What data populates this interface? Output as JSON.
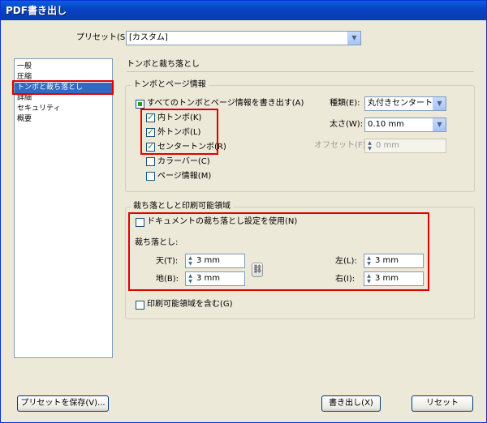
{
  "window": {
    "title": "PDF書き出し"
  },
  "preset": {
    "label": "プリセット(S):",
    "value": "[カスタム]"
  },
  "sidebar": {
    "items": [
      {
        "label": "一般"
      },
      {
        "label": "圧縮"
      },
      {
        "label": "トンボと裁ち落とし"
      },
      {
        "label": "詳細"
      },
      {
        "label": "セキュリティ"
      },
      {
        "label": "概要"
      }
    ]
  },
  "main": {
    "section_title": "トンボと裁ち落とし",
    "marks_group": {
      "title": "トンボとページ情報",
      "all_marks_label": "すべてのトンボとページ情報を書き出す(A)",
      "inner_trim_label": "内トンボ(K)",
      "outer_trim_label": "外トンボ(L)",
      "center_marks_label": "センタートンボ(R)",
      "color_bar_label": "カラーバー(C)",
      "page_info_label": "ページ情報(M)",
      "type_label": "種類(E):",
      "type_value": "丸付きセンタートンボ",
      "weight_label": "太さ(W):",
      "weight_value": "0.10 mm",
      "offset_label": "オフセット(F):",
      "offset_value": "0 mm"
    },
    "bleed_group": {
      "title": "裁ち落としと印刷可能領域",
      "use_doc_bleed_label": "ドキュメントの裁ち落とし設定を使用(N)",
      "bleed_label": "裁ち落とし:",
      "top_label": "天(T):",
      "top_value": "3 mm",
      "bottom_label": "地(B):",
      "bottom_value": "3 mm",
      "left_label": "左(L):",
      "left_value": "3 mm",
      "right_label": "右(I):",
      "right_value": "3 mm",
      "include_slug_label": "印刷可能領域を含む(G)"
    }
  },
  "footer": {
    "save_preset_label": "プリセットを保存(V)...",
    "export_label": "書き出し(X)",
    "reset_label": "リセット"
  },
  "colors": {
    "accent": "#316ac5",
    "highlight": "#e00000",
    "check": "#21a121"
  }
}
